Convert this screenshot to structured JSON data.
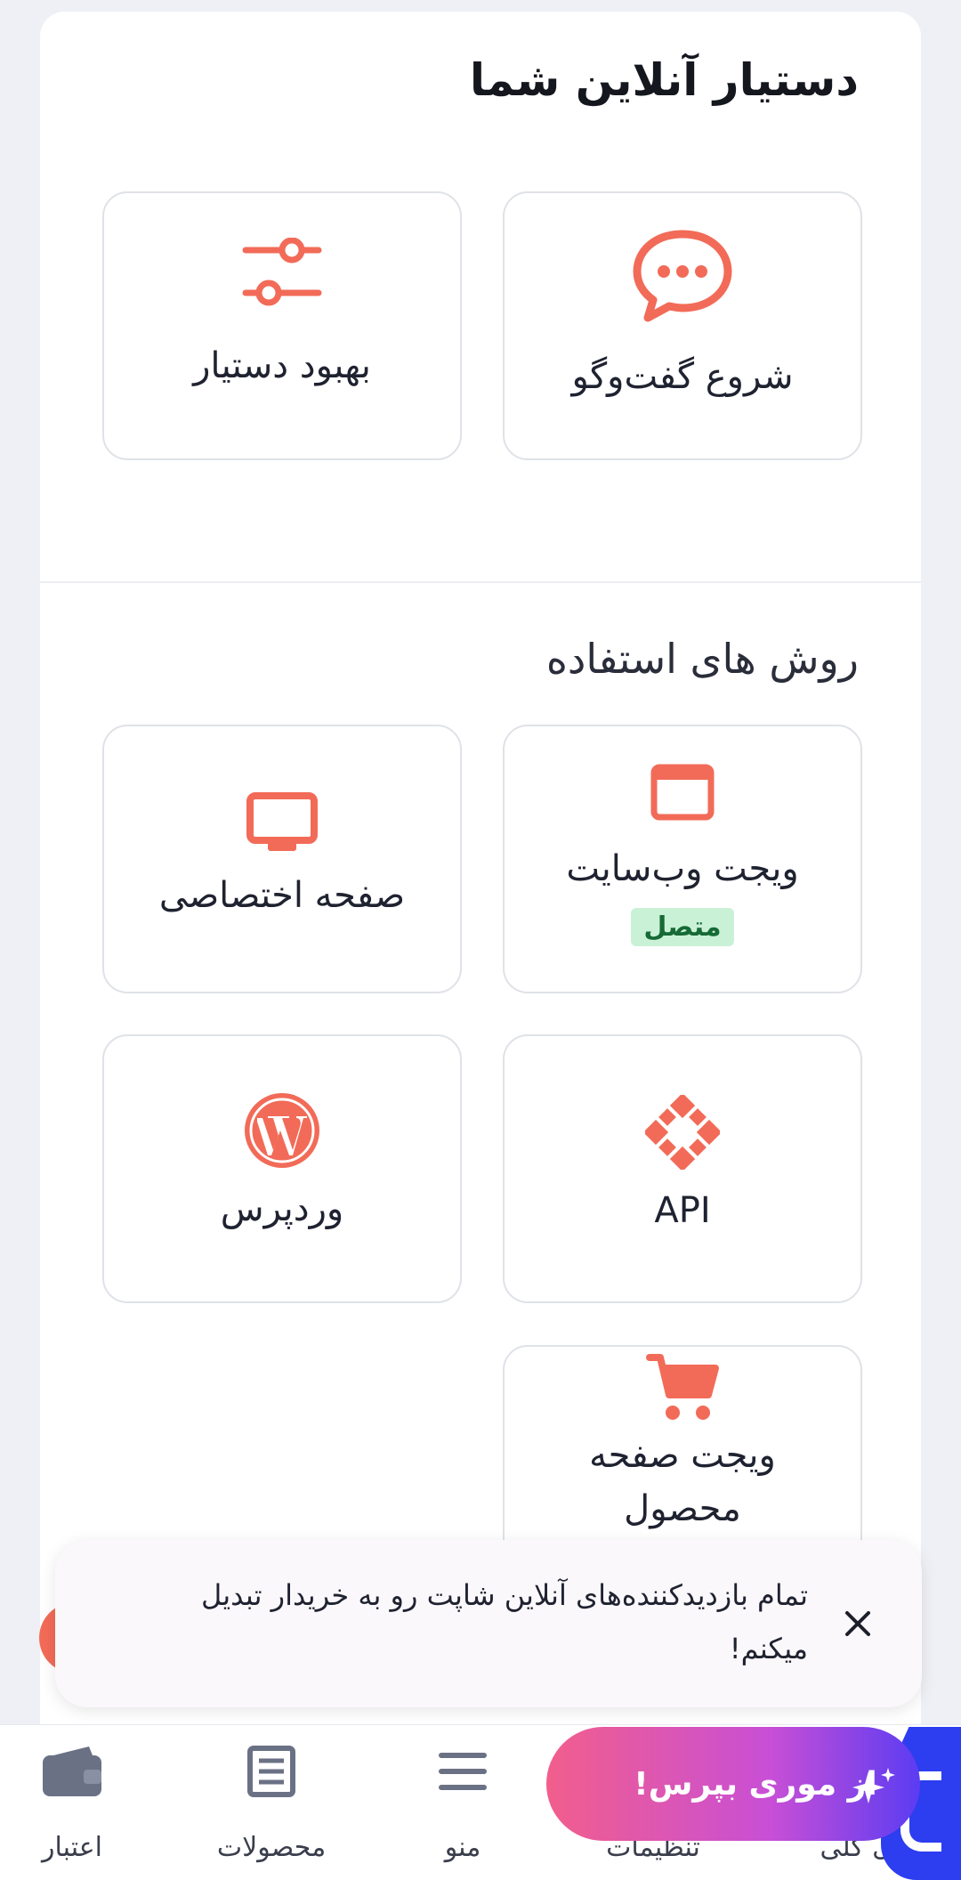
{
  "assistant": {
    "title": "دستیار آنلاین شما",
    "actions": [
      {
        "label": "شروع گفت‌وگو",
        "icon": "chat-bubble-icon"
      },
      {
        "label": "بهبود دستیار",
        "icon": "sliders-icon"
      }
    ]
  },
  "usage": {
    "title": "روش های استفاده",
    "items": [
      {
        "label": "ویجت وب‌سایت",
        "icon": "browser-window-icon",
        "badge": "متصل"
      },
      {
        "label": "صفحه اختصاصی",
        "icon": "monitor-icon"
      },
      {
        "label": "API",
        "icon": "api-diamond-icon"
      },
      {
        "label": "وردپرس",
        "icon": "wordpress-icon"
      },
      {
        "label": "ویجت صفحه محصول",
        "icon": "cart-icon"
      }
    ]
  },
  "toast": {
    "message": "تمام بازدیدکننده‌های آنلاین شاپت رو به خریدار تبدیل میکنم!"
  },
  "ask_button": {
    "label": "از موری بپرس!"
  },
  "bottom_nav": {
    "items": [
      {
        "label": "نمای کلی",
        "icon": "overview-icon"
      },
      {
        "label": "تنظیمات",
        "icon": "settings-icon"
      },
      {
        "label": "منو",
        "icon": "menu-icon"
      },
      {
        "label": "محصولات",
        "icon": "products-icon"
      },
      {
        "label": "اعتبار",
        "icon": "wallet-icon"
      }
    ]
  },
  "colors": {
    "accent": "#f26b58",
    "badge_bg": "#c9f1d6",
    "badge_text": "#166a35",
    "nav_icon": "#6b7185"
  }
}
